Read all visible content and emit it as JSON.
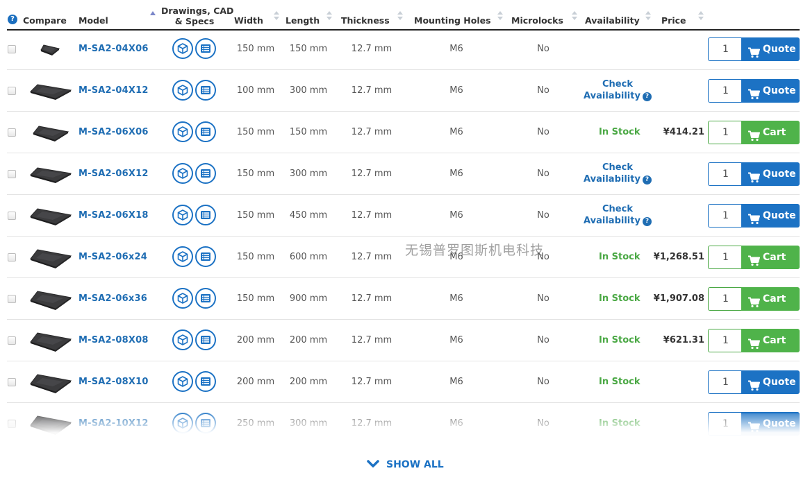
{
  "headers": {
    "compare": "Compare",
    "model": "Model",
    "drawings_line1": "Drawings, CAD",
    "drawings_line2": "& Specs",
    "width": "Width",
    "length": "Length",
    "thickness": "Thickness",
    "mounting_holes": "Mounting Holes",
    "microlocks": "Microlocks",
    "availability": "Availability",
    "price": "Price",
    "help_glyph": "?"
  },
  "check_availability_line1": "Check",
  "check_availability_line2": "Availability",
  "check_help_glyph": "?",
  "rows": [
    {
      "model": "M-SA2-04X06",
      "width": "150 mm",
      "length": "150 mm",
      "thickness": "12.7 mm",
      "holes": "M6",
      "microlocks": "No",
      "availability": "",
      "price": "",
      "qty": "1",
      "button": "Quote"
    },
    {
      "model": "M-SA2-04X12",
      "width": "100 mm",
      "length": "300 mm",
      "thickness": "12.7 mm",
      "holes": "M6",
      "microlocks": "No",
      "availability": "check",
      "price": "",
      "qty": "1",
      "button": "Quote"
    },
    {
      "model": "M-SA2-06X06",
      "width": "150 mm",
      "length": "150 mm",
      "thickness": "12.7 mm",
      "holes": "M6",
      "microlocks": "No",
      "availability": "In Stock",
      "price": "¥414.21",
      "qty": "1",
      "button": "Cart"
    },
    {
      "model": "M-SA2-06X12",
      "width": "150 mm",
      "length": "300 mm",
      "thickness": "12.7 mm",
      "holes": "M6",
      "microlocks": "No",
      "availability": "check",
      "price": "",
      "qty": "1",
      "button": "Quote"
    },
    {
      "model": "M-SA2-06X18",
      "width": "150 mm",
      "length": "450 mm",
      "thickness": "12.7 mm",
      "holes": "M6",
      "microlocks": "No",
      "availability": "check",
      "price": "",
      "qty": "1",
      "button": "Quote"
    },
    {
      "model": "M-SA2-06x24",
      "width": "150 mm",
      "length": "600 mm",
      "thickness": "12.7 mm",
      "holes": "M6",
      "microlocks": "No",
      "availability": "In Stock",
      "price": "¥1,268.51",
      "qty": "1",
      "button": "Cart"
    },
    {
      "model": "M-SA2-06x36",
      "width": "150 mm",
      "length": "900 mm",
      "thickness": "12.7 mm",
      "holes": "M6",
      "microlocks": "No",
      "availability": "In Stock",
      "price": "¥1,907.08",
      "qty": "1",
      "button": "Cart"
    },
    {
      "model": "M-SA2-08X08",
      "width": "200 mm",
      "length": "200 mm",
      "thickness": "12.7 mm",
      "holes": "M6",
      "microlocks": "No",
      "availability": "In Stock",
      "price": "¥621.31",
      "qty": "1",
      "button": "Cart"
    },
    {
      "model": "M-SA2-08X10",
      "width": "200 mm",
      "length": "200 mm",
      "thickness": "12.7 mm",
      "holes": "M6",
      "microlocks": "No",
      "availability": "In Stock",
      "price": "",
      "qty": "1",
      "button": "Quote"
    },
    {
      "model": "M-SA2-10X12",
      "width": "250 mm",
      "length": "300 mm",
      "thickness": "12.7 mm",
      "holes": "M6",
      "microlocks": "No",
      "availability": "In Stock",
      "price": "",
      "qty": "1",
      "button": "Quote"
    }
  ],
  "watermark": "无锡普罗图斯机电科技",
  "show_all": "SHOW ALL",
  "icons": {
    "cad": "cad-cube-icon",
    "specs": "specs-list-icon",
    "cart": "cart-icon",
    "chevron": "chevron-down-icon",
    "help": "help-icon"
  },
  "colors": {
    "link_blue": "#1f6db3",
    "button_blue": "#1c72c4",
    "in_stock_green": "#4aa844",
    "cart_green": "#4fb34a"
  }
}
